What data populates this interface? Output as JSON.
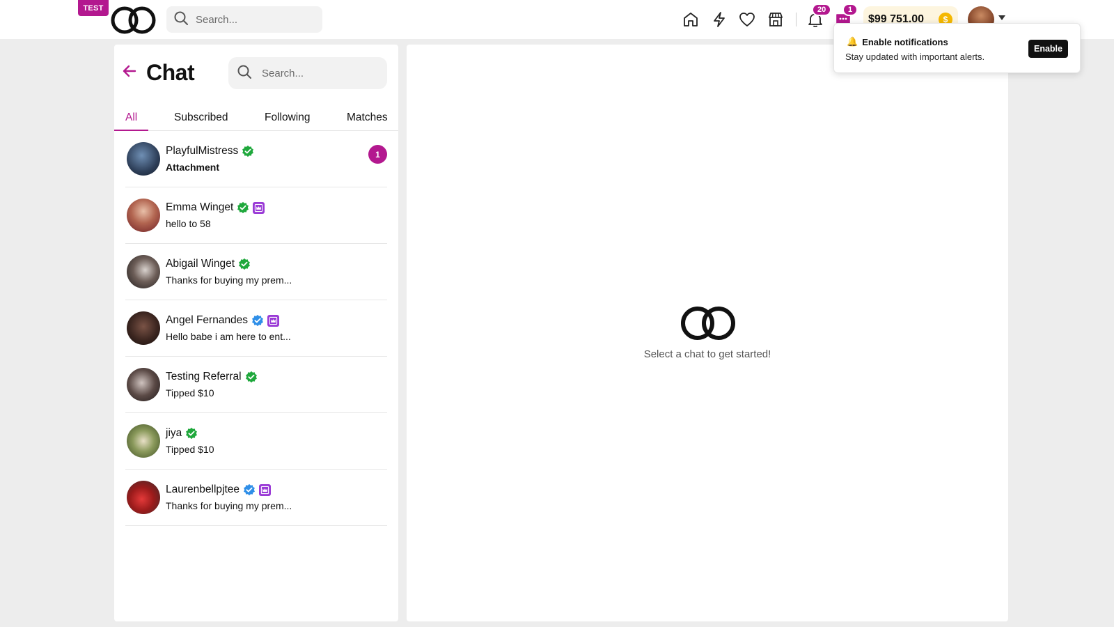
{
  "header": {
    "env_badge": "TEST",
    "search_placeholder": "Search...",
    "notifications_count": "20",
    "messages_count": "1",
    "balance": "$99 751.00",
    "coin_symbol": "$",
    "nav_icons": [
      "home-icon",
      "lightning-icon",
      "heart-icon",
      "store-icon",
      "bell-icon",
      "chat-bubble-icon"
    ]
  },
  "chat_panel": {
    "title": "Chat",
    "search_placeholder": "Search...",
    "tabs": [
      {
        "label": "All",
        "active": true
      },
      {
        "label": "Subscribed",
        "active": false
      },
      {
        "label": "Following",
        "active": false
      },
      {
        "label": "Matches",
        "active": false
      }
    ],
    "conversations": [
      {
        "name": "PlayfulMistress",
        "verified": "green",
        "premium": false,
        "last_message": "Attachment",
        "bold": true,
        "unread": "1"
      },
      {
        "name": "Emma Winget",
        "verified": "green",
        "premium": true,
        "last_message": "hello to 58",
        "bold": false,
        "unread": null
      },
      {
        "name": "Abigail Winget",
        "verified": "green",
        "premium": false,
        "last_message": "Thanks for buying my prem...",
        "bold": false,
        "unread": null
      },
      {
        "name": "Angel Fernandes",
        "verified": "blue",
        "premium": true,
        "last_message": "Hello babe i am here to ent...",
        "bold": false,
        "unread": null
      },
      {
        "name": "Testing Referral",
        "verified": "green",
        "premium": false,
        "last_message": "Tipped $10",
        "bold": false,
        "unread": null
      },
      {
        "name": "jiya",
        "verified": "green",
        "premium": false,
        "last_message": "Tipped $10",
        "bold": false,
        "unread": null
      },
      {
        "name": "Laurenbellpjtee",
        "verified": "blue",
        "premium": true,
        "last_message": "Thanks for buying my prem...",
        "bold": false,
        "unread": null
      }
    ]
  },
  "main": {
    "empty_state_text": "Select a chat to get started!"
  },
  "notification_prompt": {
    "icon": "🔔",
    "title": "Enable notifications",
    "body": "Stay updated with important alerts.",
    "button_label": "Enable"
  },
  "colors": {
    "accent": "#b3188f",
    "verified_green": "#1fa83c",
    "verified_blue": "#2f8fe8",
    "premium_purple": "#9a3ad6",
    "balance_bg": "#fdf5df",
    "coin": "#f5b800"
  }
}
